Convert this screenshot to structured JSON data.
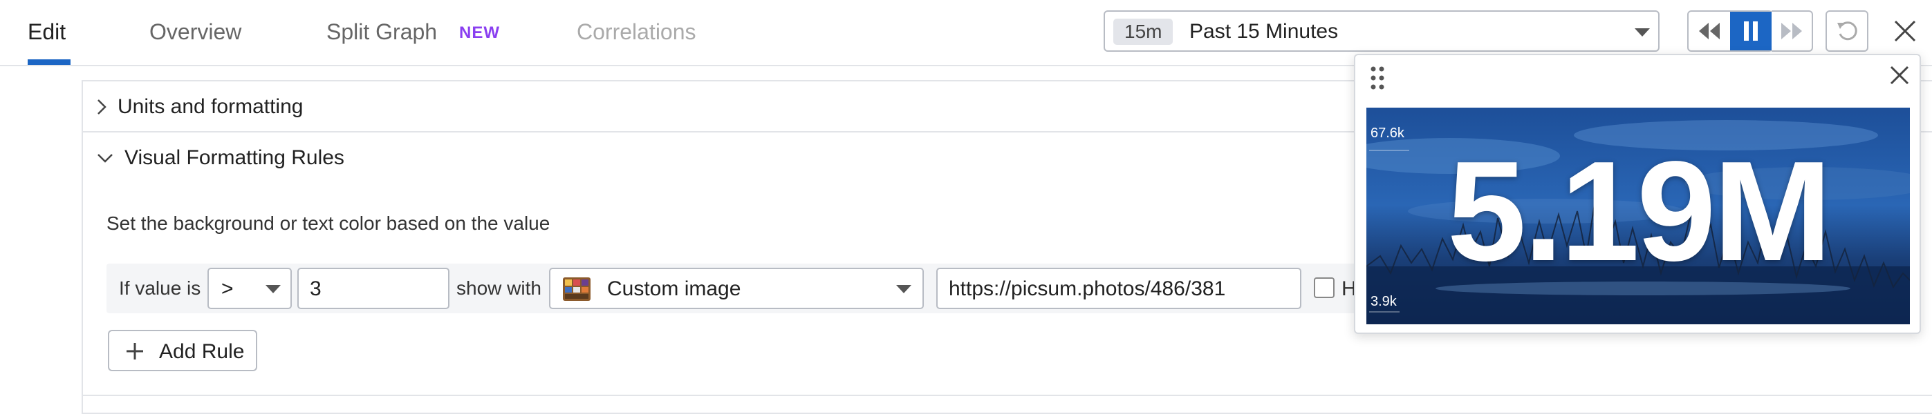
{
  "tabs": {
    "edit": "Edit",
    "overview": "Overview",
    "split_graph": "Split Graph",
    "new_badge": "NEW",
    "correlations": "Correlations"
  },
  "time": {
    "chip": "15m",
    "label": "Past 15 Minutes"
  },
  "sections": {
    "units": "Units and formatting",
    "visual_rules": "Visual Formatting Rules"
  },
  "rules": {
    "description": "Set the background or text color based on the value",
    "if_value_is": "If value is",
    "operator": ">",
    "threshold": "3",
    "show_with": "show with",
    "style": "Custom image",
    "image_url": "https://picsum.photos/486/381",
    "checkbox_label": "H",
    "add_rule": "Add Rule"
  },
  "preview": {
    "value": "5.19M",
    "y_max": "67.6k",
    "y_min": "3.9k"
  },
  "colors": {
    "accent": "#1c66c4",
    "new_badge": "#8a3ff0"
  }
}
